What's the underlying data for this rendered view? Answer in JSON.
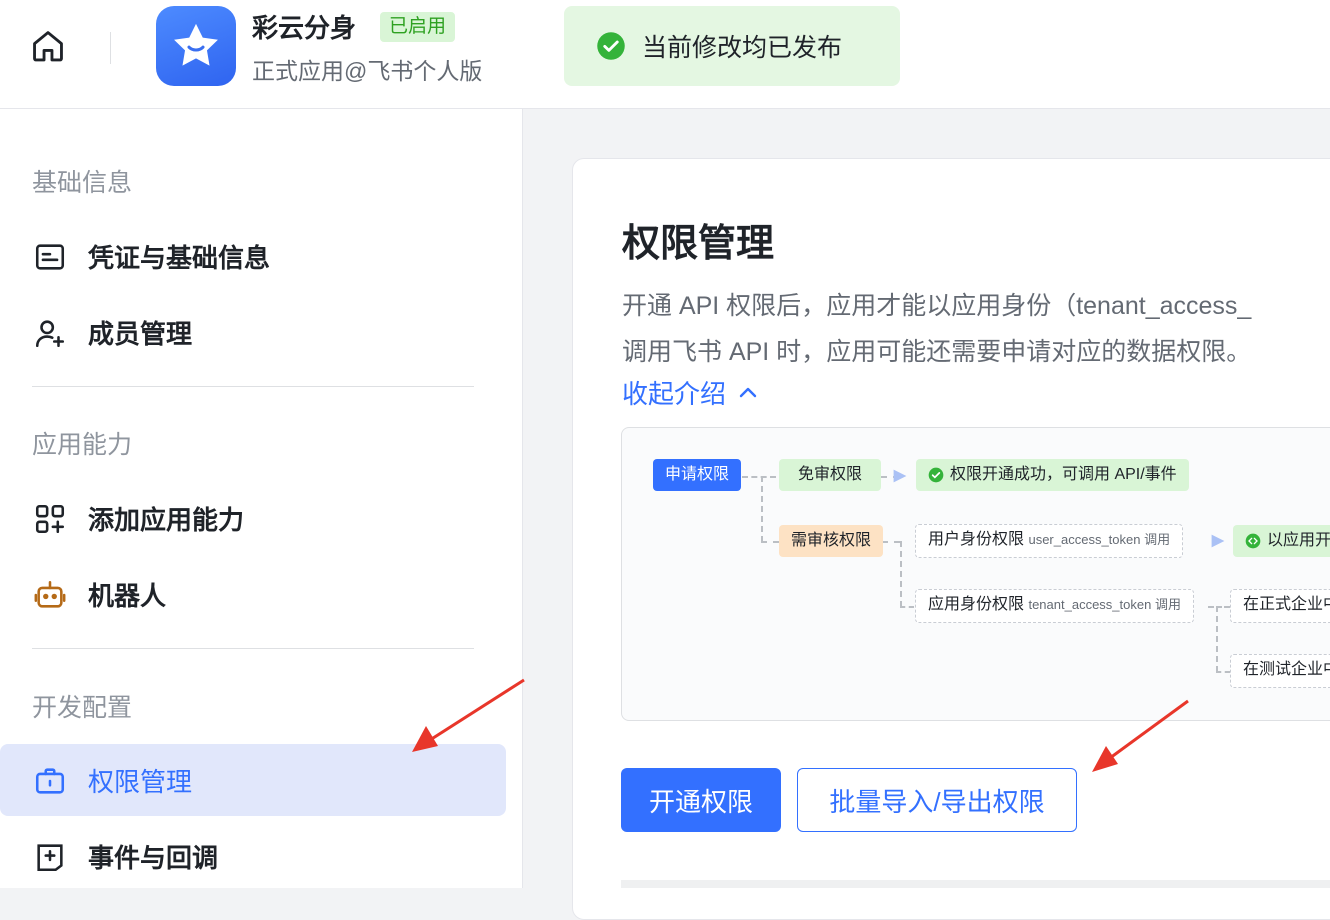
{
  "header": {
    "app_name": "彩云分身",
    "app_status": "已启用",
    "app_subtitle": "正式应用@飞书个人版",
    "toast_text": "当前修改均已发布"
  },
  "sidebar": {
    "sections": [
      {
        "title": "基础信息",
        "items": [
          {
            "label": "凭证与基础信息",
            "icon": "credential-icon"
          },
          {
            "label": "成员管理",
            "icon": "add-member-icon"
          }
        ]
      },
      {
        "title": "应用能力",
        "items": [
          {
            "label": "添加应用能力",
            "icon": "add-capability-icon"
          },
          {
            "label": "机器人",
            "icon": "robot-icon"
          }
        ]
      },
      {
        "title": "开发配置",
        "items": [
          {
            "label": "权限管理",
            "icon": "briefcase-icon",
            "active": true
          },
          {
            "label": "事件与回调",
            "icon": "event-icon"
          }
        ]
      }
    ]
  },
  "main": {
    "title": "权限管理",
    "desc_line1": "开通 API 权限后，应用才能以应用身份（tenant_access_",
    "desc_line2": "调用飞书 API 时，应用可能还需要申请对应的数据权限。",
    "collapse_label": "收起介绍",
    "diagram": {
      "apply": "申请权限",
      "free": "免审权限",
      "success": "权限开通成功，可调用 API/事件",
      "review": "需审核权限",
      "user_perm": "用户身份权限",
      "user_token": "user_access_token 调用",
      "app_open": "以应用开",
      "app_perm": "应用身份权限",
      "tenant_token": "tenant_access_token 调用",
      "formal": "在正式企业中",
      "test": "在测试企业中"
    },
    "primary_button": "开通权限",
    "secondary_button": "批量导入/导出权限"
  },
  "colors": {
    "accent": "#3370ff",
    "success": "#2ea121",
    "arrow": "#e8362a"
  }
}
